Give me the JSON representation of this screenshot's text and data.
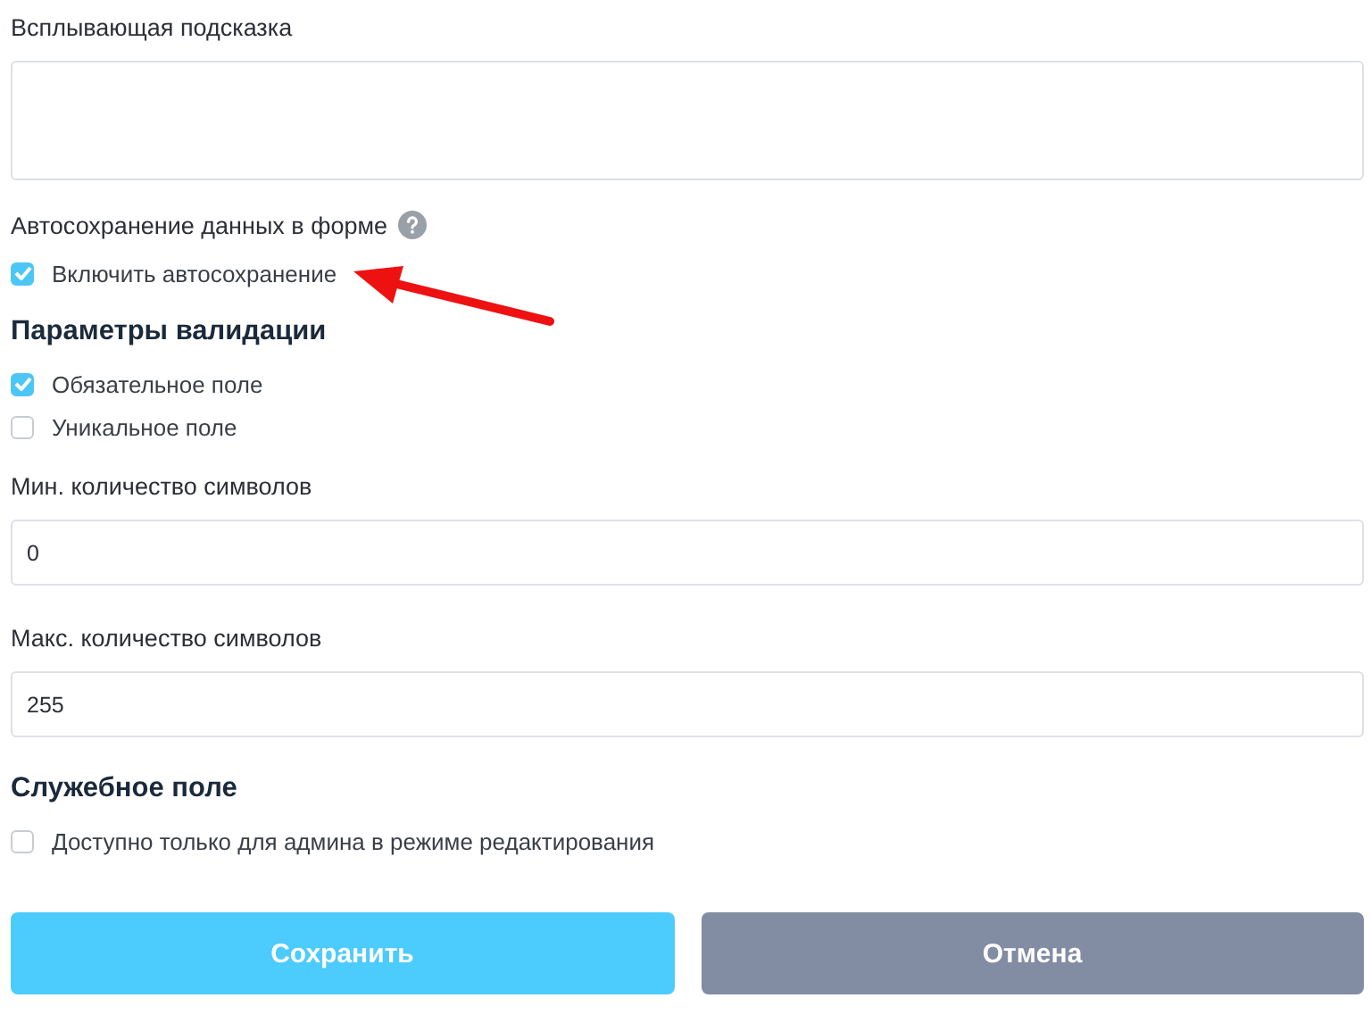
{
  "form": [
    {
      "kind": "label",
      "text": "Всплывающая подсказка",
      "help": false
    },
    {
      "kind": "textarea"
    },
    {
      "kind": "label",
      "text": "Автосохранение данных в форме",
      "help": true
    },
    {
      "kind": "checkbox",
      "text": "Включить автосохранение",
      "checked": true
    },
    {
      "kind": "heading",
      "text": "Параметры валидации"
    },
    {
      "kind": "checkbox",
      "text": "Обязательное поле",
      "checked": true
    },
    {
      "kind": "checkbox",
      "text": "Уникальное поле",
      "checked": false
    },
    {
      "kind": "label",
      "text": "Мин. количество символов",
      "help": false
    },
    {
      "kind": "input",
      "value": "0"
    },
    {
      "kind": "label",
      "text": "Макс. количество символов",
      "help": false
    },
    {
      "kind": "input",
      "value": "255"
    },
    {
      "kind": "heading",
      "text": "Служебное поле"
    },
    {
      "kind": "checkbox",
      "text": "Доступно только для админа в режиме редактирования",
      "checked": false
    }
  ],
  "buttons": [
    {
      "kind": "primary",
      "label": "Сохранить"
    },
    {
      "kind": "secondary",
      "label": "Отмена"
    }
  ]
}
